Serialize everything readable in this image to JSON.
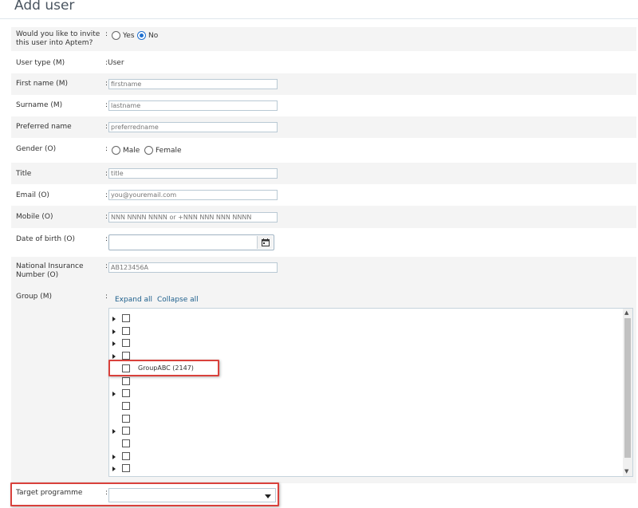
{
  "page": {
    "title": "Add user"
  },
  "form": {
    "invite": {
      "label": "Would you like to invite this user into Aptem?",
      "options": [
        "Yes",
        "No"
      ],
      "selected": "No"
    },
    "user_type": {
      "label": "User type (M)",
      "value": "User"
    },
    "first_name": {
      "label": "First name (M)",
      "placeholder": "firstname"
    },
    "surname": {
      "label": "Surname (M)",
      "placeholder": "lastname"
    },
    "preferred_name": {
      "label": "Preferred name",
      "placeholder": "preferredname"
    },
    "gender": {
      "label": "Gender (O)",
      "options": [
        "Male",
        "Female"
      ],
      "selected": null
    },
    "title": {
      "label": "Title",
      "placeholder": "title"
    },
    "email": {
      "label": "Email (O)",
      "placeholder": "you@youremail.com"
    },
    "mobile": {
      "label": "Mobile  (O)",
      "placeholder": "NNN NNNN NNNN or +NNN NNN NNN NNNN"
    },
    "dob": {
      "label": "Date of birth (O)",
      "value": ""
    },
    "ni_number": {
      "label": "National Insurance Number (O)",
      "placeholder": "AB123456A"
    },
    "group": {
      "label": "Group (M)",
      "expand_all": "Expand all",
      "collapse_all": "Collapse all",
      "items": [
        {
          "label": "",
          "expandable": true,
          "checked": false
        },
        {
          "label": "",
          "expandable": true,
          "checked": false
        },
        {
          "label": "",
          "expandable": true,
          "checked": false
        },
        {
          "label": "",
          "expandable": true,
          "checked": false
        },
        {
          "label": "GroupABC (2147)",
          "expandable": false,
          "checked": false,
          "highlighted": true
        },
        {
          "label": "",
          "expandable": false,
          "checked": false
        },
        {
          "label": "",
          "expandable": true,
          "checked": false
        },
        {
          "label": "",
          "expandable": false,
          "checked": false
        },
        {
          "label": "",
          "expandable": false,
          "checked": false
        },
        {
          "label": "",
          "expandable": true,
          "checked": false
        },
        {
          "label": "",
          "expandable": false,
          "checked": false
        },
        {
          "label": "",
          "expandable": true,
          "checked": false
        },
        {
          "label": "",
          "expandable": true,
          "checked": false
        }
      ]
    },
    "target_programme": {
      "label": "Target programme",
      "value": ""
    }
  },
  "colon": ":",
  "colors": {
    "highlight": "#d9413c",
    "link": "#1d5f8c",
    "row_shade": "#f4f4f4"
  },
  "icons": {
    "calendar": "calendar-icon",
    "dropdown": "chevron-down-icon",
    "expander": "caret-right-icon"
  }
}
